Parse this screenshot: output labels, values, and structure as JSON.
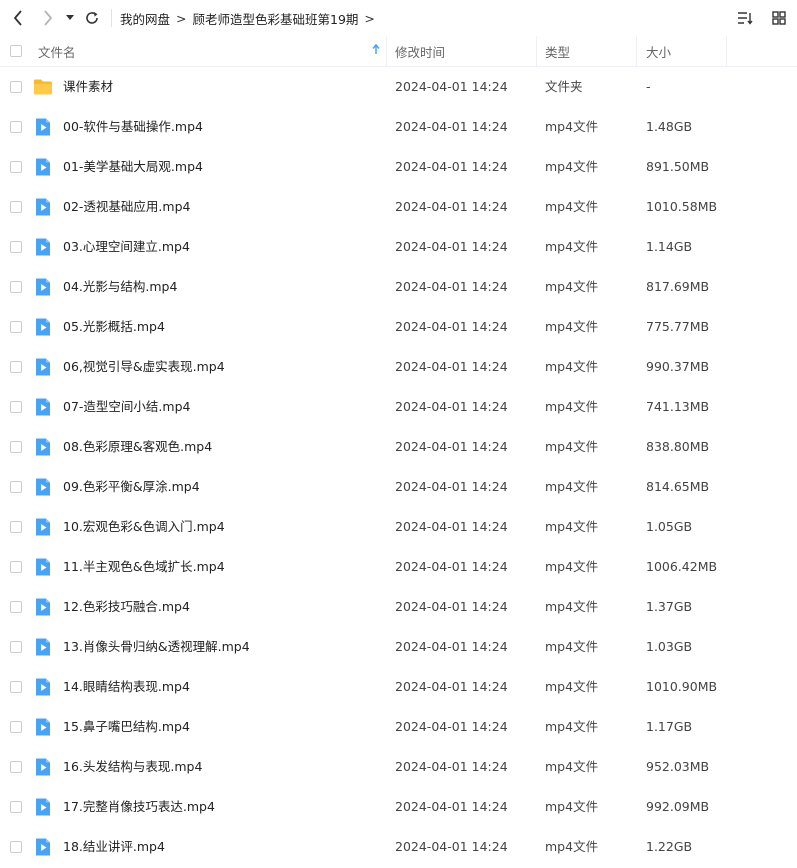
{
  "toolbar": {
    "breadcrumbs": [
      "我的网盘",
      "顾老师造型色彩基础班第19期"
    ],
    "separator": ">"
  },
  "header": {
    "name": "文件名",
    "time": "修改时间",
    "type": "类型",
    "size": "大小"
  },
  "colors": {
    "folder": "#f7b92e",
    "video": "#4aa3f0"
  },
  "files": [
    {
      "name": "课件素材",
      "time": "2024-04-01 14:24",
      "type": "文件夹",
      "size": "-",
      "icon": "folder-icon"
    },
    {
      "name": "00-软件与基础操作.mp4",
      "time": "2024-04-01 14:24",
      "type": "mp4文件",
      "size": "1.48GB",
      "icon": "video-file-icon"
    },
    {
      "name": "01-美学基础大局观.mp4",
      "time": "2024-04-01 14:24",
      "type": "mp4文件",
      "size": "891.50MB",
      "icon": "video-file-icon"
    },
    {
      "name": "02-透视基础应用.mp4",
      "time": "2024-04-01 14:24",
      "type": "mp4文件",
      "size": "1010.58MB",
      "icon": "video-file-icon"
    },
    {
      "name": "03.心理空间建立.mp4",
      "time": "2024-04-01 14:24",
      "type": "mp4文件",
      "size": "1.14GB",
      "icon": "video-file-icon"
    },
    {
      "name": "04.光影与结构.mp4",
      "time": "2024-04-01 14:24",
      "type": "mp4文件",
      "size": "817.69MB",
      "icon": "video-file-icon"
    },
    {
      "name": "05.光影概括.mp4",
      "time": "2024-04-01 14:24",
      "type": "mp4文件",
      "size": "775.77MB",
      "icon": "video-file-icon"
    },
    {
      "name": "06,视觉引导&虚实表现.mp4",
      "time": "2024-04-01 14:24",
      "type": "mp4文件",
      "size": "990.37MB",
      "icon": "video-file-icon"
    },
    {
      "name": "07-造型空间小结.mp4",
      "time": "2024-04-01 14:24",
      "type": "mp4文件",
      "size": "741.13MB",
      "icon": "video-file-icon"
    },
    {
      "name": "08.色彩原理&客观色.mp4",
      "time": "2024-04-01 14:24",
      "type": "mp4文件",
      "size": "838.80MB",
      "icon": "video-file-icon"
    },
    {
      "name": "09.色彩平衡&厚涂.mp4",
      "time": "2024-04-01 14:24",
      "type": "mp4文件",
      "size": "814.65MB",
      "icon": "video-file-icon"
    },
    {
      "name": "10.宏观色彩&色调入门.mp4",
      "time": "2024-04-01 14:24",
      "type": "mp4文件",
      "size": "1.05GB",
      "icon": "video-file-icon"
    },
    {
      "name": "11.半主观色&色域扩长.mp4",
      "time": "2024-04-01 14:24",
      "type": "mp4文件",
      "size": "1006.42MB",
      "icon": "video-file-icon"
    },
    {
      "name": "12.色彩技巧融合.mp4",
      "time": "2024-04-01 14:24",
      "type": "mp4文件",
      "size": "1.37GB",
      "icon": "video-file-icon"
    },
    {
      "name": "13.肖像头骨归纳&透视理解.mp4",
      "time": "2024-04-01 14:24",
      "type": "mp4文件",
      "size": "1.03GB",
      "icon": "video-file-icon"
    },
    {
      "name": "14.眼睛结构表现.mp4",
      "time": "2024-04-01 14:24",
      "type": "mp4文件",
      "size": "1010.90MB",
      "icon": "video-file-icon"
    },
    {
      "name": "15.鼻子嘴巴结构.mp4",
      "time": "2024-04-01 14:24",
      "type": "mp4文件",
      "size": "1.17GB",
      "icon": "video-file-icon"
    },
    {
      "name": "16.头发结构与表现.mp4",
      "time": "2024-04-01 14:24",
      "type": "mp4文件",
      "size": "952.03MB",
      "icon": "video-file-icon"
    },
    {
      "name": "17.完整肖像技巧表达.mp4",
      "time": "2024-04-01 14:24",
      "type": "mp4文件",
      "size": "992.09MB",
      "icon": "video-file-icon"
    },
    {
      "name": "18.结业讲评.mp4",
      "time": "2024-04-01 14:24",
      "type": "mp4文件",
      "size": "1.22GB",
      "icon": "video-file-icon"
    }
  ]
}
